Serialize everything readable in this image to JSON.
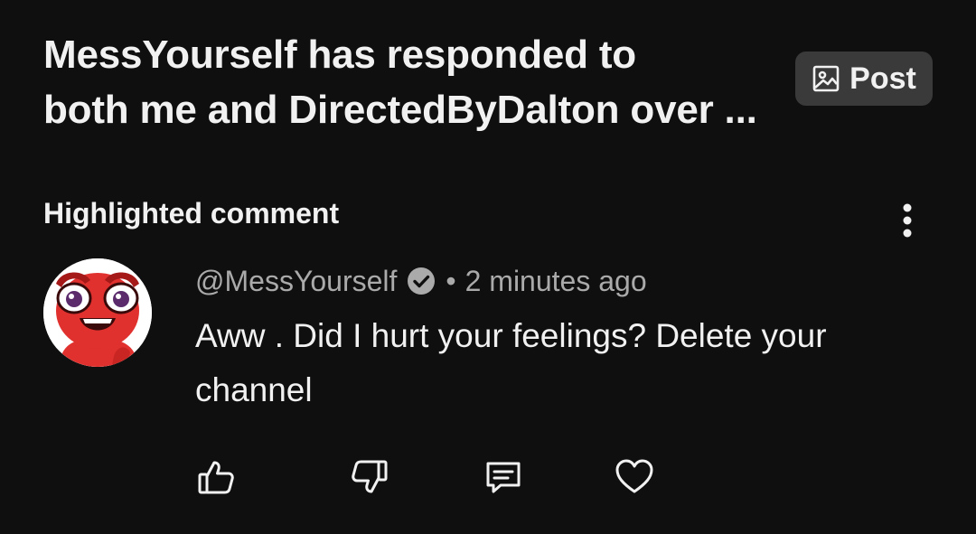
{
  "post": {
    "title": "MessYourself has responded to\nboth me and DirectedByDalton over ...",
    "post_button_label": "Post",
    "post_button_icon": "image-icon"
  },
  "section": {
    "label": "Highlighted comment",
    "menu_icon": "more-vertical-icon"
  },
  "comment": {
    "handle": "@MessYourself",
    "verified_icon": "verified-check-icon",
    "separator": "•",
    "time": "2 minutes ago",
    "text": "Aww . Did I hurt your feelings? Delete your channel",
    "avatar_colors": {
      "background": "#ffffff",
      "character": "#e0312e"
    }
  },
  "actions": [
    {
      "name": "like",
      "icon": "thumbs-up-icon"
    },
    {
      "name": "dislike",
      "icon": "thumbs-down-icon"
    },
    {
      "name": "reply",
      "icon": "comment-icon"
    },
    {
      "name": "heart",
      "icon": "heart-icon"
    }
  ],
  "colors": {
    "background": "#0f0f0f",
    "text_primary": "#f1f1f1",
    "text_secondary": "#aaaaaa",
    "button_bg": "#3a3a3a"
  }
}
